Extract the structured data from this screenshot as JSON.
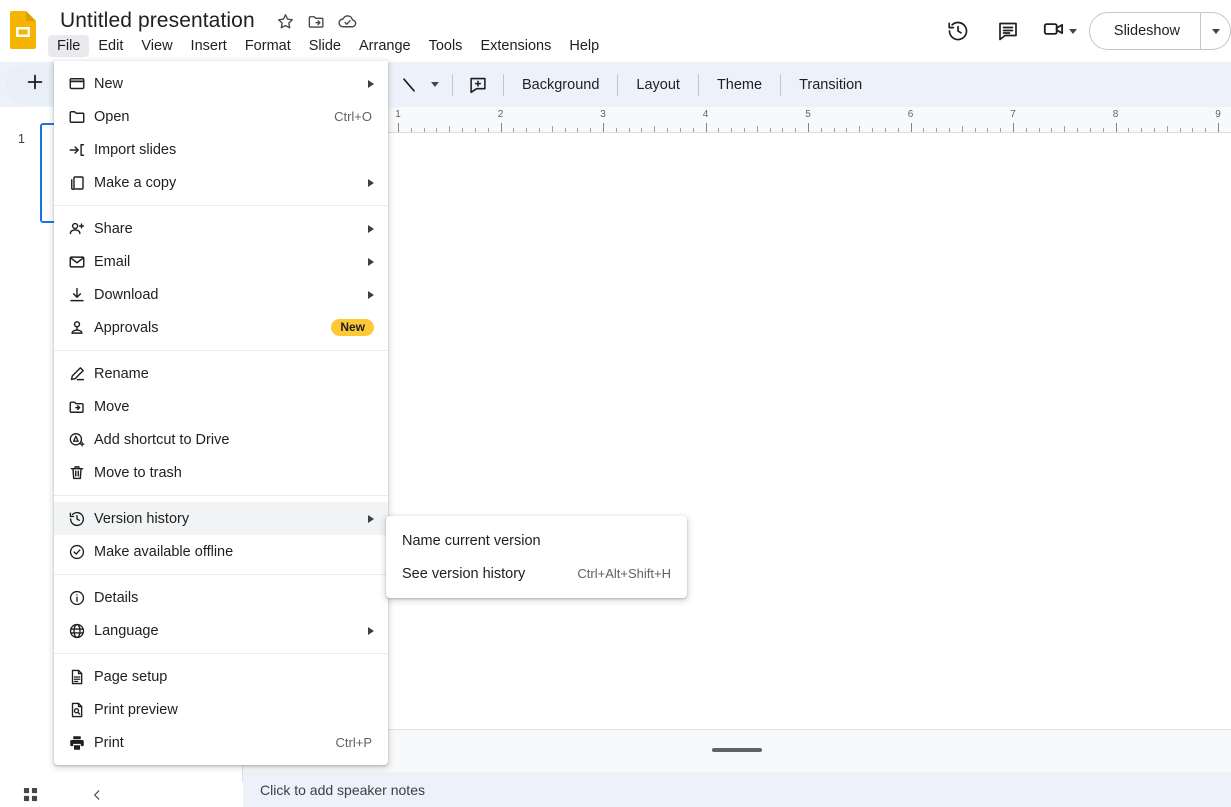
{
  "app": {
    "title": "Untitled presentation",
    "title_icons": [
      "star-icon",
      "move-to-folder-icon",
      "cloud-saved-icon"
    ]
  },
  "menubar": {
    "items": [
      {
        "label": "File",
        "active": true
      },
      {
        "label": "Edit",
        "active": false
      },
      {
        "label": "View",
        "active": false
      },
      {
        "label": "Insert",
        "active": false
      },
      {
        "label": "Format",
        "active": false
      },
      {
        "label": "Slide",
        "active": false
      },
      {
        "label": "Arrange",
        "active": false
      },
      {
        "label": "Tools",
        "active": false
      },
      {
        "label": "Extensions",
        "active": false
      },
      {
        "label": "Help",
        "active": false
      }
    ]
  },
  "topright": {
    "history_icon": "version-history-icon",
    "comment_icon": "comment-icon",
    "meet_icon": "video-camera-icon",
    "slideshow_label": "Slideshow"
  },
  "toolbar": {
    "new_slide_icon": "plus-icon",
    "line_tool_icon": "line-icon",
    "textbox_icon": "comment-box-icon",
    "background_label": "Background",
    "layout_label": "Layout",
    "theme_label": "Theme",
    "transition_label": "Transition"
  },
  "ruler": {
    "labels": [
      "1",
      "2",
      "3",
      "4",
      "5",
      "6",
      "7",
      "8",
      "9"
    ]
  },
  "filmstrip": {
    "slide_number": "1"
  },
  "notes": {
    "placeholder": "Click to add speaker notes"
  },
  "bottombar": {
    "grid_icon": "grid-view-icon",
    "collapse_icon": "chevron-left-icon"
  },
  "file_menu": {
    "sections": [
      {
        "rows": [
          {
            "icon": "new-presentation-icon",
            "label": "New",
            "arrow": true
          },
          {
            "icon": "folder-open-icon",
            "label": "Open",
            "shortcut": "Ctrl+O"
          },
          {
            "icon": "import-slides-icon",
            "label": "Import slides"
          },
          {
            "icon": "copy-icon",
            "label": "Make a copy",
            "arrow": true
          }
        ]
      },
      {
        "rows": [
          {
            "icon": "person-add-icon",
            "label": "Share",
            "arrow": true
          },
          {
            "icon": "email-icon",
            "label": "Email",
            "arrow": true
          },
          {
            "icon": "download-icon",
            "label": "Download",
            "arrow": true
          },
          {
            "icon": "approvals-icon",
            "label": "Approvals",
            "badge": "New"
          }
        ]
      },
      {
        "rows": [
          {
            "icon": "rename-pencil-icon",
            "label": "Rename"
          },
          {
            "icon": "move-folder-icon",
            "label": "Move"
          },
          {
            "icon": "add-shortcut-drive-icon",
            "label": "Add shortcut to Drive"
          },
          {
            "icon": "trash-icon",
            "label": "Move to trash"
          }
        ]
      },
      {
        "rows": [
          {
            "icon": "version-history-icon",
            "label": "Version history",
            "arrow": true,
            "highlighted": true
          },
          {
            "icon": "offline-check-icon",
            "label": "Make available offline"
          }
        ]
      },
      {
        "rows": [
          {
            "icon": "info-icon",
            "label": "Details"
          },
          {
            "icon": "globe-icon",
            "label": "Language",
            "arrow": true
          }
        ]
      },
      {
        "rows": [
          {
            "icon": "page-setup-icon",
            "label": "Page setup"
          },
          {
            "icon": "print-preview-icon",
            "label": "Print preview"
          },
          {
            "icon": "printer-icon",
            "label": "Print",
            "shortcut": "Ctrl+P"
          }
        ]
      }
    ]
  },
  "version_history_submenu": {
    "rows": [
      {
        "label": "Name current version"
      },
      {
        "label": "See version history",
        "shortcut": "Ctrl+Alt+Shift+H"
      }
    ]
  },
  "colors": {
    "accent": "#1a73e8",
    "toolbar_bg": "#edf2fa",
    "badge": "#fcc934",
    "logo": "#f5b400"
  }
}
